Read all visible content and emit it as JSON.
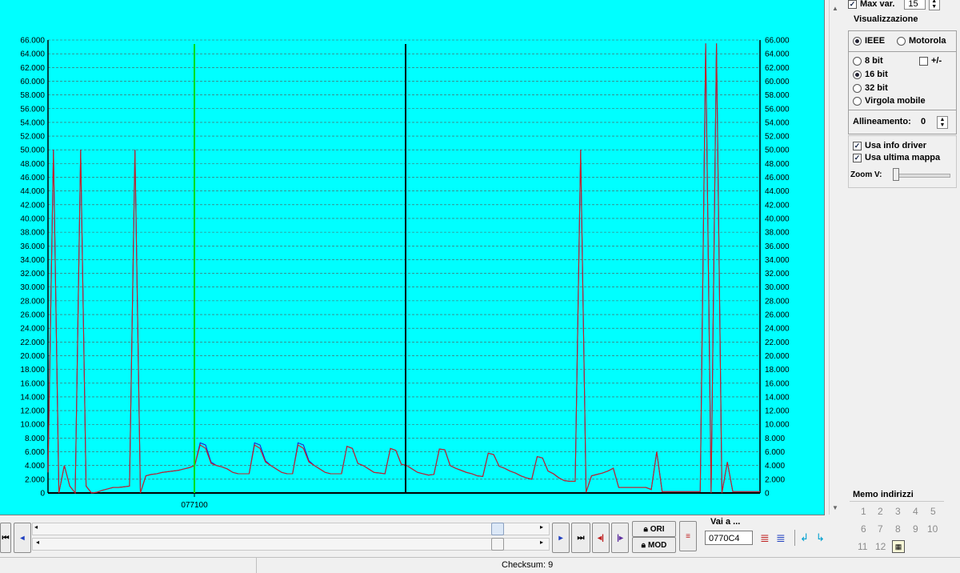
{
  "top": {
    "max_var_label": "Max var.",
    "max_var_value": "15"
  },
  "visualizzazione": {
    "title": "Visualizzazione",
    "ieee": "IEEE",
    "motorola": "Motorola",
    "bit8": "8 bit",
    "plusminus": "+/-",
    "bit16": "16 bit",
    "bit32": "32 bit",
    "virgola": "Virgola mobile",
    "allineamento_label": "Allineamento:",
    "allineamento_value": "0",
    "usa_info_driver": "Usa info driver",
    "usa_ultima_mappa": "Usa ultima mappa",
    "zoom_label": "Zoom V:"
  },
  "memo": {
    "title": "Memo indirizzi",
    "numbers": [
      "1",
      "2",
      "3",
      "4",
      "5",
      "6",
      "7",
      "8",
      "9",
      "10",
      "11",
      "12"
    ]
  },
  "bottom": {
    "ori_label": "ORI",
    "mod_label": "MOD",
    "vai_label": "Vai a ...",
    "vai_value": "0770C4"
  },
  "status": {
    "checksum": "Checksum: 9"
  },
  "colors": {
    "background": "#00ffff",
    "series_modified": "#cc2222",
    "series_original": "#2222cc",
    "cursor_green": "#00e000",
    "cursor_black": "#000000"
  },
  "chart_data": {
    "type": "line",
    "y_ticks": [
      "0",
      "2.000",
      "4.000",
      "6.000",
      "8.000",
      "10.000",
      "12.000",
      "14.000",
      "16.000",
      "18.000",
      "20.000",
      "22.000",
      "24.000",
      "26.000",
      "28.000",
      "30.000",
      "32.000",
      "34.000",
      "36.000",
      "38.000",
      "40.000",
      "42.000",
      "44.000",
      "46.000",
      "48.000",
      "50.000",
      "52.000",
      "54.000",
      "56.000",
      "58.000",
      "60.000",
      "62.000",
      "64.000",
      "66.000"
    ],
    "ylim": [
      0,
      66000
    ],
    "x_label": "077100",
    "grid": true,
    "series": [
      {
        "values": [
          3000,
          50000,
          0,
          4000,
          1000,
          0,
          50000,
          1000,
          0,
          100,
          400,
          600,
          800,
          800,
          900,
          1000,
          50000,
          0,
          2500,
          2700,
          2800,
          3000,
          3100,
          3200,
          3300,
          3500,
          3700,
          4000,
          7000,
          6500,
          4300,
          4000,
          3800,
          3500,
          3000,
          2800,
          2800,
          2800,
          7000,
          6500,
          4500,
          4000,
          3500,
          3000,
          2800,
          2800,
          7000,
          6500,
          4500,
          4000,
          3500,
          3000,
          2800,
          2800,
          2800,
          6800,
          6500,
          4300,
          4000,
          3500,
          3000,
          2900,
          2800,
          6500,
          6200,
          4200,
          4000,
          3500,
          3000,
          2800,
          2600,
          2700,
          6400,
          6300,
          4000,
          3600,
          3300,
          3000,
          2800,
          2500,
          2400,
          5800,
          5600,
          3900,
          3600,
          3200,
          2900,
          2500,
          2200,
          2000,
          5300,
          5100,
          3200,
          2800,
          2200,
          1800,
          1700,
          1700,
          50000,
          100,
          2500,
          2700,
          2900,
          3200,
          3600,
          800,
          800,
          800,
          800,
          800,
          800,
          500,
          6000,
          200,
          200,
          200,
          200,
          200,
          200,
          200,
          200,
          65500,
          0,
          65500,
          0,
          4500,
          200,
          200,
          200,
          200,
          200,
          200
        ],
        "name": ""
      },
      {
        "values": [
          3000,
          50000,
          0,
          4000,
          1000,
          0,
          50000,
          1000,
          0,
          100,
          400,
          600,
          800,
          800,
          900,
          1000,
          50000,
          0,
          2500,
          2700,
          2800,
          3000,
          3100,
          3200,
          3300,
          3500,
          3700,
          4000,
          7300,
          7000,
          4500,
          4000,
          3800,
          3500,
          3000,
          2800,
          2800,
          2800,
          7300,
          7000,
          4700,
          4000,
          3500,
          3000,
          2800,
          2800,
          7300,
          7000,
          4700,
          4000,
          3500,
          3000,
          2800,
          2800,
          2800,
          6800,
          6500,
          4300,
          4000,
          3500,
          3000,
          2900,
          2800,
          6500,
          6200,
          4200,
          4000,
          3500,
          3000,
          2800,
          2600,
          2700,
          6400,
          6300,
          4000,
          3600,
          3300,
          3000,
          2800,
          2500,
          2400,
          5800,
          5600,
          3900,
          3600,
          3200,
          2900,
          2500,
          2200,
          2000,
          5300,
          5100,
          3200,
          2800,
          2200,
          1800,
          1700,
          1700,
          50000,
          100,
          2500,
          2700,
          2900,
          3200,
          3600,
          800,
          800,
          800,
          800,
          800,
          800,
          500,
          6000,
          200,
          200,
          200,
          200,
          200,
          200,
          200,
          200,
          65500,
          0,
          65500,
          0,
          4500,
          200,
          200,
          200,
          200,
          200,
          200
        ],
        "name": ""
      }
    ]
  }
}
